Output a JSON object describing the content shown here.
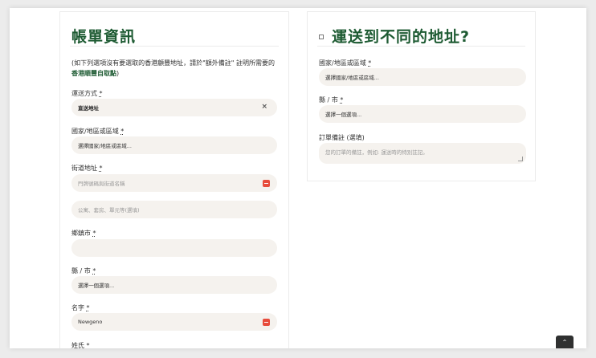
{
  "billing": {
    "title": "帳單資訊",
    "notice_prefix": "(如下列選項沒有要選取的香港顧豐地址，請於\"額外備註\" 註明所需要的",
    "notice_link": "香港順豐自取點",
    "notice_suffix": ")",
    "fields": {
      "shipping_method": {
        "label": "運送方式",
        "required": "*",
        "value": "直送地址",
        "clear": "×"
      },
      "country": {
        "label": "國家/地區或區域",
        "required": "*",
        "value": "選擇國家/地區或區域..."
      },
      "street": {
        "label": "街道地址",
        "required": "*",
        "placeholder": "門牌號碼與街道名稱"
      },
      "street2": {
        "placeholder": "公寓、套房、單元等(選填)"
      },
      "township": {
        "label": "鄉鎮市",
        "required": "*",
        "value": ""
      },
      "county": {
        "label": "縣 / 市",
        "required": "*",
        "value": "選擇一個選項..."
      },
      "first_name": {
        "label": "名字",
        "required": "*",
        "value": "Newgeno"
      },
      "last_name": {
        "label": "姓氏",
        "required": "*"
      }
    }
  },
  "shipping": {
    "title": "運送到不同的地址?",
    "fields": {
      "country": {
        "label": "國家/地區或區域",
        "required": "*",
        "value": "選擇國家/地區或區域..."
      },
      "county": {
        "label": "縣 / 市",
        "required": "*",
        "value": "選擇一個選項..."
      },
      "notes": {
        "label": "訂單備註 (選填)",
        "placeholder": "您的訂單的備註，例如: 運送時的特別註記。"
      }
    }
  },
  "scroll_top": {
    "icon": "chevron-up-icon",
    "glyph": "⌃"
  }
}
